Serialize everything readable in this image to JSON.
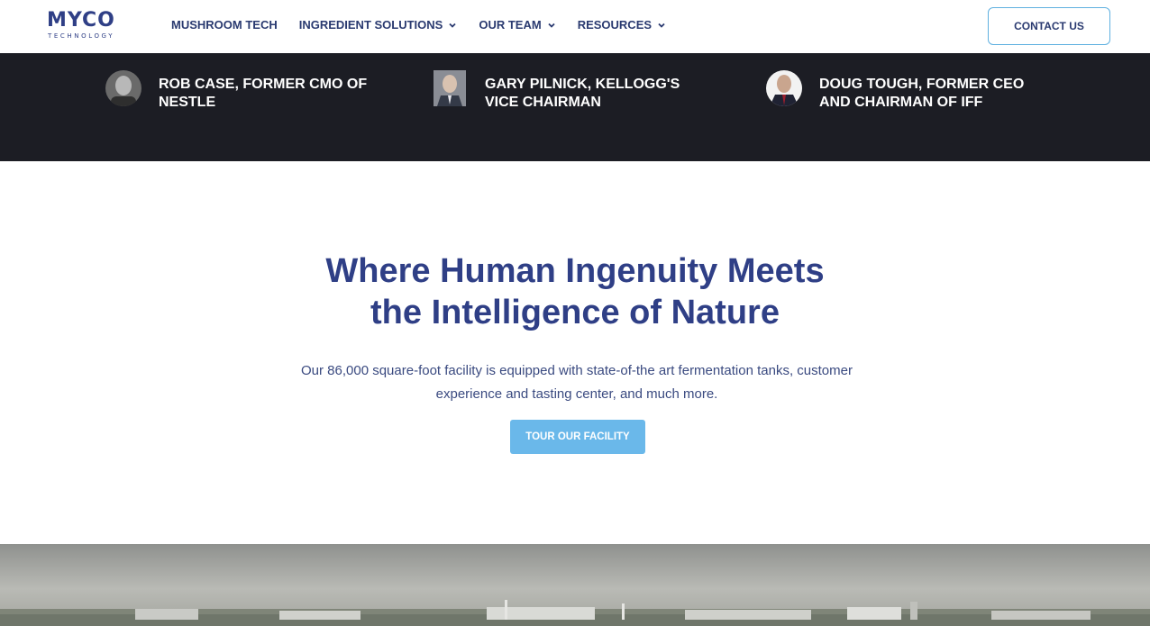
{
  "header": {
    "logo_main": "MYCO",
    "logo_sub": "TECHNOLOGY",
    "nav": [
      {
        "label": "MUSHROOM TECH",
        "has_dropdown": false
      },
      {
        "label": "INGREDIENT SOLUTIONS",
        "has_dropdown": true
      },
      {
        "label": "OUR TEAM",
        "has_dropdown": true
      },
      {
        "label": "RESOURCES",
        "has_dropdown": true
      }
    ],
    "contact_label": "CONTACT US"
  },
  "team": [
    {
      "name": "ROB CASE, FORMER CMO OF NESTLE"
    },
    {
      "name": "GARY PILNICK, KELLOGG'S VICE CHAIRMAN"
    },
    {
      "name": "DOUG TOUGH, FORMER CEO AND CHAIRMAN OF IFF"
    }
  ],
  "hero": {
    "title_line1": "Where Human Ingenuity Meets",
    "title_line2": "the Intelligence of Nature",
    "description": "Our 86,000 square-foot facility is equipped with state-of-the art fermentation tanks, customer experience and tasting center, and much more.",
    "button_label": "TOUR OUR FACILITY"
  },
  "colors": {
    "brand_navy": "#2f3f86",
    "accent_blue": "#6ab8ea",
    "dark_band": "#1c1d24"
  }
}
